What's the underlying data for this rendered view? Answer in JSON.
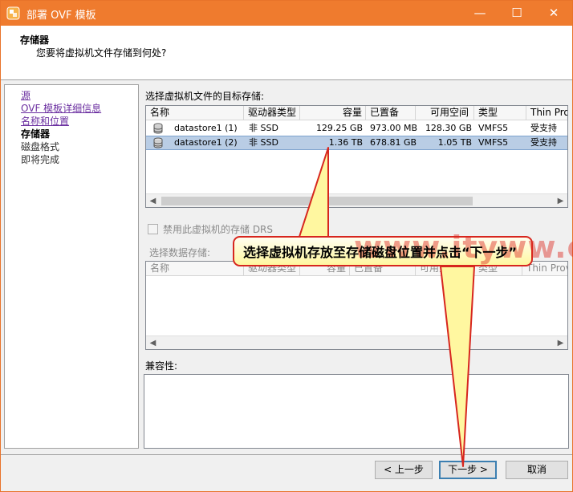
{
  "window": {
    "title": "部署 OVF 模板",
    "min_glyph": "—",
    "max_glyph": "☐",
    "close_glyph": "✕"
  },
  "header": {
    "title": "存储器",
    "subtitle": "您要将虚拟机文件存储到何处?"
  },
  "nav": {
    "items": [
      {
        "label": "源",
        "state": "link"
      },
      {
        "label": "OVF 模板详细信息",
        "state": "link"
      },
      {
        "label": "名称和位置",
        "state": "link"
      },
      {
        "label": "存储器",
        "state": "current"
      },
      {
        "label": "磁盘格式",
        "state": "pending"
      },
      {
        "label": "即将完成",
        "state": "pending"
      }
    ]
  },
  "target_storage": {
    "label": "选择虚拟机文件的目标存储:",
    "columns": [
      "名称",
      "驱动器类型",
      "容量",
      "已置备",
      "可用空间",
      "类型",
      "Thin Prov"
    ],
    "rows": [
      {
        "name": "datastore1 (1)",
        "drive": "非 SSD",
        "capacity": "129.25 GB",
        "provisioned": "973.00 MB",
        "free": "128.30 GB",
        "type": "VMFS5",
        "thin": "受支持",
        "selected": false
      },
      {
        "name": "datastore1 (2)",
        "drive": "非 SSD",
        "capacity": "1.36 TB",
        "provisioned": "678.81 GB",
        "free": "1.05 TB",
        "type": "VMFS5",
        "thin": "受支持",
        "selected": true
      }
    ]
  },
  "drs": {
    "label": "禁用此虚拟机的存储 DRS",
    "checked": false
  },
  "datastore": {
    "label": "选择数据存储:",
    "columns": [
      "名称",
      "驱动器类型",
      "容量",
      "已置备",
      "可用空间",
      "类型",
      "Thin Provi"
    ]
  },
  "compat": {
    "label": "兼容性:"
  },
  "buttons": {
    "prev": "< 上一步",
    "next": "下一步 >",
    "cancel": "取消"
  },
  "callout": {
    "text": "选择虚拟机存放至存储磁盘位置并点击“下一步”",
    "watermark": "www.ityww.cn"
  },
  "colors": {
    "titlebar": "#ef7b2e",
    "selection": "#b9cde5",
    "callout_border": "#d7261e",
    "callout_fill": "#fff7a0",
    "nav_link": "#6b2fa0"
  }
}
